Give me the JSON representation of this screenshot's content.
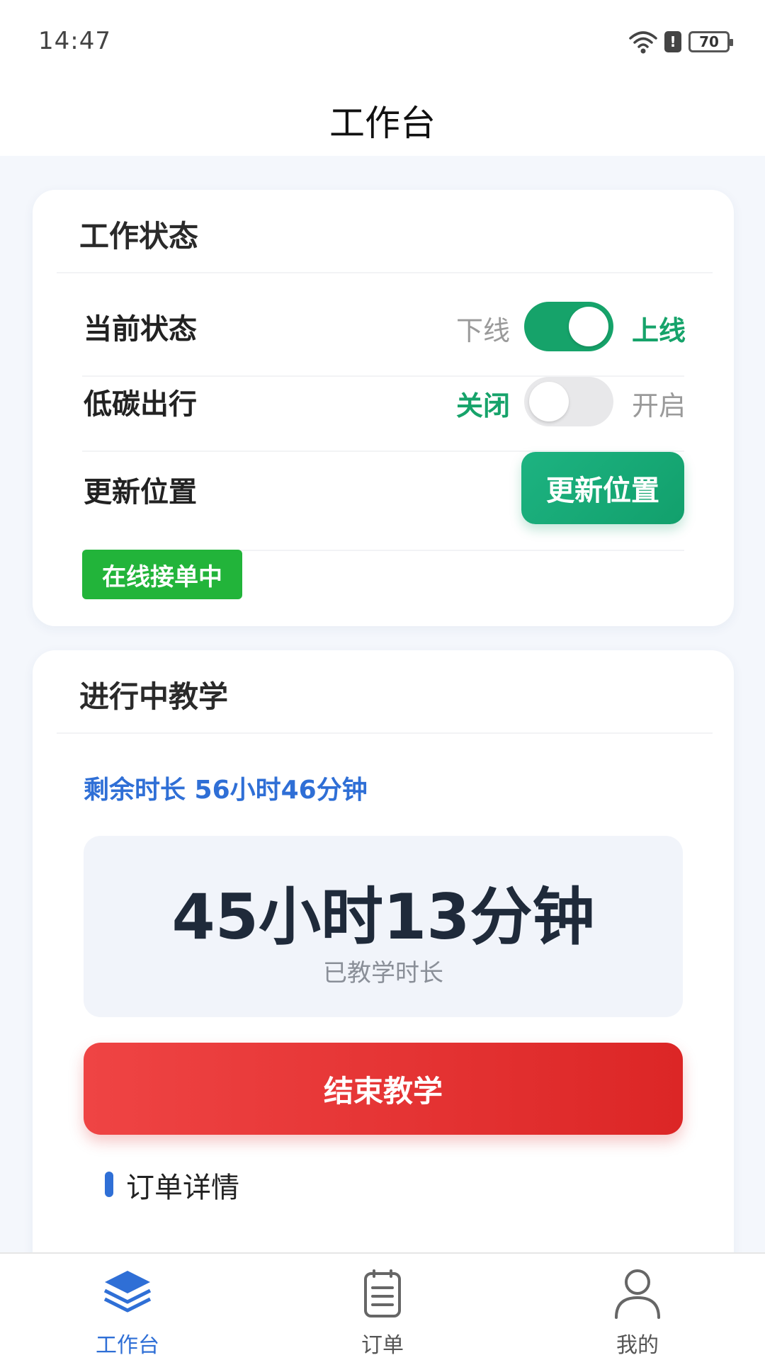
{
  "status_bar": {
    "time": "14:47",
    "battery": "70",
    "alert": "!"
  },
  "header": {
    "title": "工作台"
  },
  "work_status": {
    "title": "工作状态",
    "current_status": {
      "label": "当前状态",
      "off_text": "下线",
      "on_text": "上线",
      "enabled": true
    },
    "low_carbon": {
      "label": "低碳出行",
      "off_text": "关闭",
      "on_text": "开启",
      "enabled": false
    },
    "update_location": {
      "label": "更新位置",
      "button": "更新位置"
    },
    "badge": "在线接单中"
  },
  "teaching": {
    "title": "进行中教学",
    "remaining": "剩余时长 56小时46分钟",
    "elapsed_value": "45小时13分钟",
    "elapsed_label": "已教学时长",
    "end_button": "结束教学",
    "order_section": "订单详情"
  },
  "tabbar": {
    "items": [
      {
        "label": "工作台",
        "icon": "layers-icon",
        "active": true
      },
      {
        "label": "订单",
        "icon": "document-list-icon",
        "active": false
      },
      {
        "label": "我的",
        "icon": "user-icon",
        "active": false
      }
    ]
  },
  "colors": {
    "accent_green": "#16a36a",
    "accent_blue": "#2f6fd6",
    "danger_red": "#dc2626",
    "badge_green": "#22b43a"
  }
}
